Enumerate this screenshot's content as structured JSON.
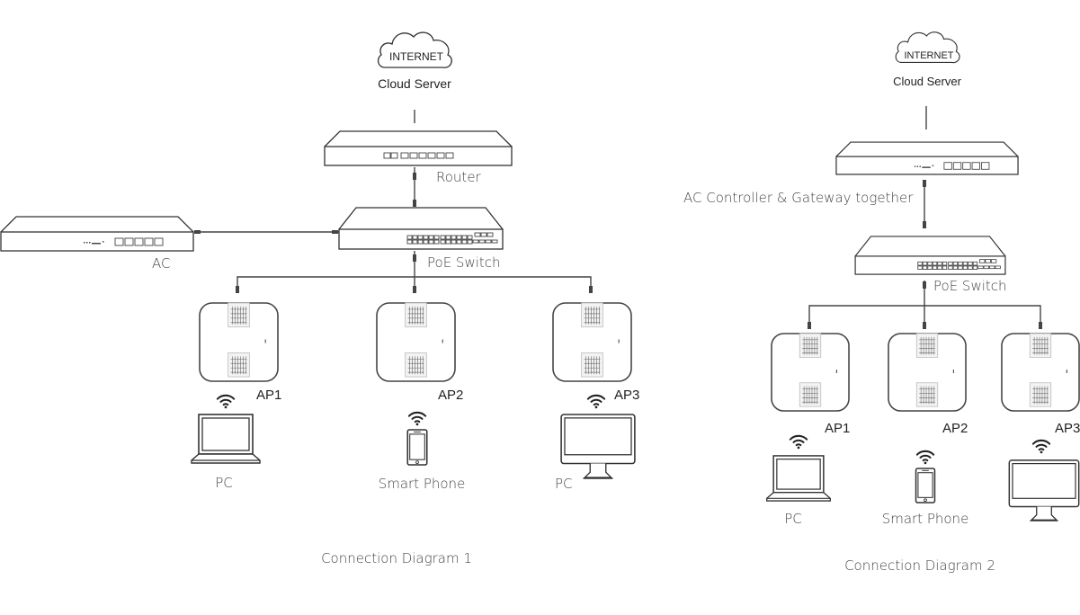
{
  "diagram1": {
    "caption": "Connection Diagram 1",
    "cloud": {
      "label": "INTERNET",
      "caption": "Cloud Server"
    },
    "router": {
      "label": "Router"
    },
    "ac": {
      "label": "AC"
    },
    "switch": {
      "label": "PoE Switch"
    },
    "aps": [
      {
        "label": "AP1",
        "client": "PC",
        "client_type": "laptop"
      },
      {
        "label": "AP2",
        "client": "Smart Phone",
        "client_type": "phone"
      },
      {
        "label": "AP3",
        "client": "PC",
        "client_type": "desktop"
      }
    ]
  },
  "diagram2": {
    "caption": "Connection Diagram 2",
    "cloud": {
      "label": "INTERNET",
      "caption": "Cloud Server"
    },
    "gateway": {
      "label": "AC Controller & Gateway together"
    },
    "switch": {
      "label": "PoE Switch"
    },
    "aps": [
      {
        "label": "AP1",
        "client": "PC",
        "client_type": "laptop"
      },
      {
        "label": "AP2",
        "client": "Smart Phone",
        "client_type": "phone"
      },
      {
        "label": "AP3",
        "client": "",
        "client_type": "desktop"
      }
    ]
  },
  "icons": {
    "cloud": "cloud-icon",
    "wifi": "wifi-icon",
    "laptop": "laptop-icon",
    "phone": "smartphone-icon",
    "desktop": "desktop-icon"
  }
}
